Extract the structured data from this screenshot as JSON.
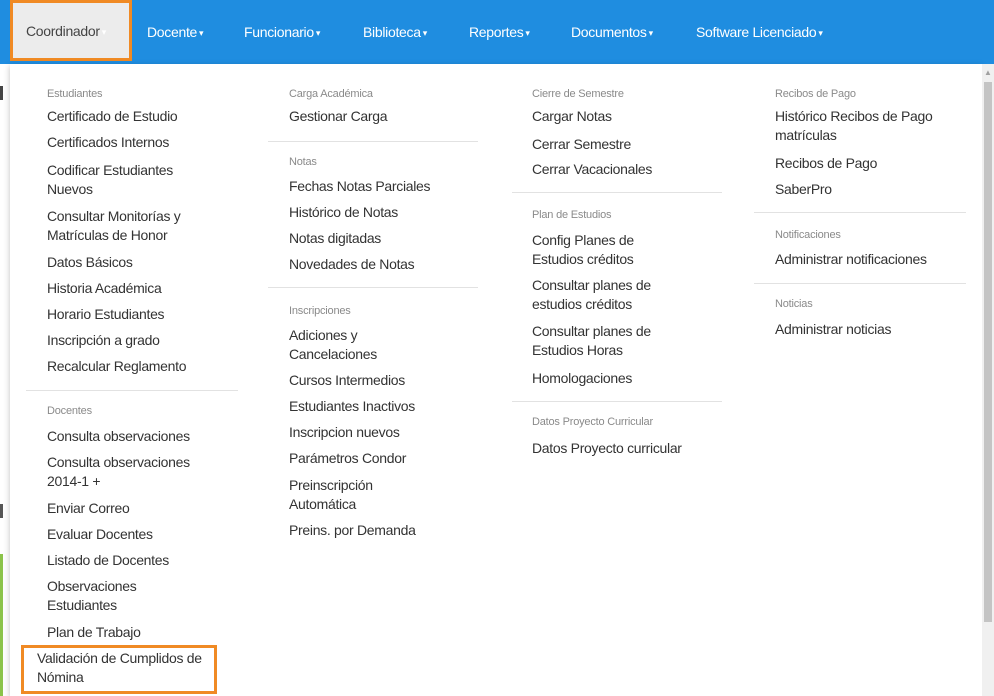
{
  "nav": {
    "items": [
      {
        "label": "Coordinador",
        "active": true
      },
      {
        "label": "Docente",
        "active": false
      },
      {
        "label": "Funcionario",
        "active": false
      },
      {
        "label": "Biblioteca",
        "active": false
      },
      {
        "label": "Reportes",
        "active": false
      },
      {
        "label": "Documentos",
        "active": false
      },
      {
        "label": "Software Licenciado",
        "active": false
      }
    ],
    "caret": "▾"
  },
  "menu": {
    "col1": {
      "estudiantes": {
        "header": "Estudiantes",
        "items": [
          "Certificado de Estudio",
          "Certificados Internos",
          "Codificar Estudiantes Nuevos",
          "Consultar Monitorías y Matrículas de Honor",
          "Datos Básicos",
          "Historia Académica",
          "Horario Estudiantes",
          "Inscripción a grado",
          "Recalcular Reglamento"
        ]
      },
      "docentes": {
        "header": "Docentes",
        "items": [
          "Consulta observaciones",
          "Consulta observaciones 2014-1 +",
          "Enviar Correo",
          "Evaluar Docentes",
          "Listado de Docentes",
          "Observaciones Estudiantes",
          "Plan de Trabajo",
          "Validación de Cumplidos de Nómina"
        ]
      }
    },
    "col2": {
      "carga": {
        "header": "Carga Académica",
        "items": [
          "Gestionar Carga"
        ]
      },
      "notas": {
        "header": "Notas",
        "items": [
          "Fechas Notas Parciales",
          "Histórico de Notas",
          "Notas digitadas",
          "Novedades de Notas"
        ]
      },
      "inscripciones": {
        "header": "Inscripciones",
        "items": [
          "Adiciones y Cancelaciones",
          "Cursos Intermedios",
          "Estudiantes Inactivos",
          "Inscripcion nuevos",
          "Parámetros Condor",
          "Preinscripción Automática",
          "Preins. por Demanda"
        ]
      }
    },
    "col3": {
      "cierre": {
        "header": "Cierre de Semestre",
        "items": [
          "Cargar Notas",
          "Cerrar Semestre",
          "Cerrar Vacacionales"
        ]
      },
      "plan": {
        "header": "Plan de Estudios",
        "items": [
          "Config Planes de Estudios créditos",
          "Consultar planes de estudios créditos",
          "Consultar planes de Estudios Horas",
          "Homologaciones"
        ]
      },
      "proyecto": {
        "header": "Datos Proyecto Curricular",
        "items": [
          "Datos Proyecto curricular"
        ]
      }
    },
    "col4": {
      "recibos": {
        "header": "Recibos de Pago",
        "items": [
          "Histórico Recibos de Pago matrículas",
          "Recibos de Pago",
          "SaberPro"
        ]
      },
      "notificaciones": {
        "header": "Notificaciones",
        "items": [
          "Administrar notificaciones"
        ]
      },
      "noticias": {
        "header": "Noticias",
        "items": [
          "Administrar noticias"
        ]
      }
    }
  },
  "colors": {
    "navbar": "#1f8de0",
    "highlight": "#f08a24",
    "header_text": "#8a8a8a",
    "item_text": "#333333"
  }
}
